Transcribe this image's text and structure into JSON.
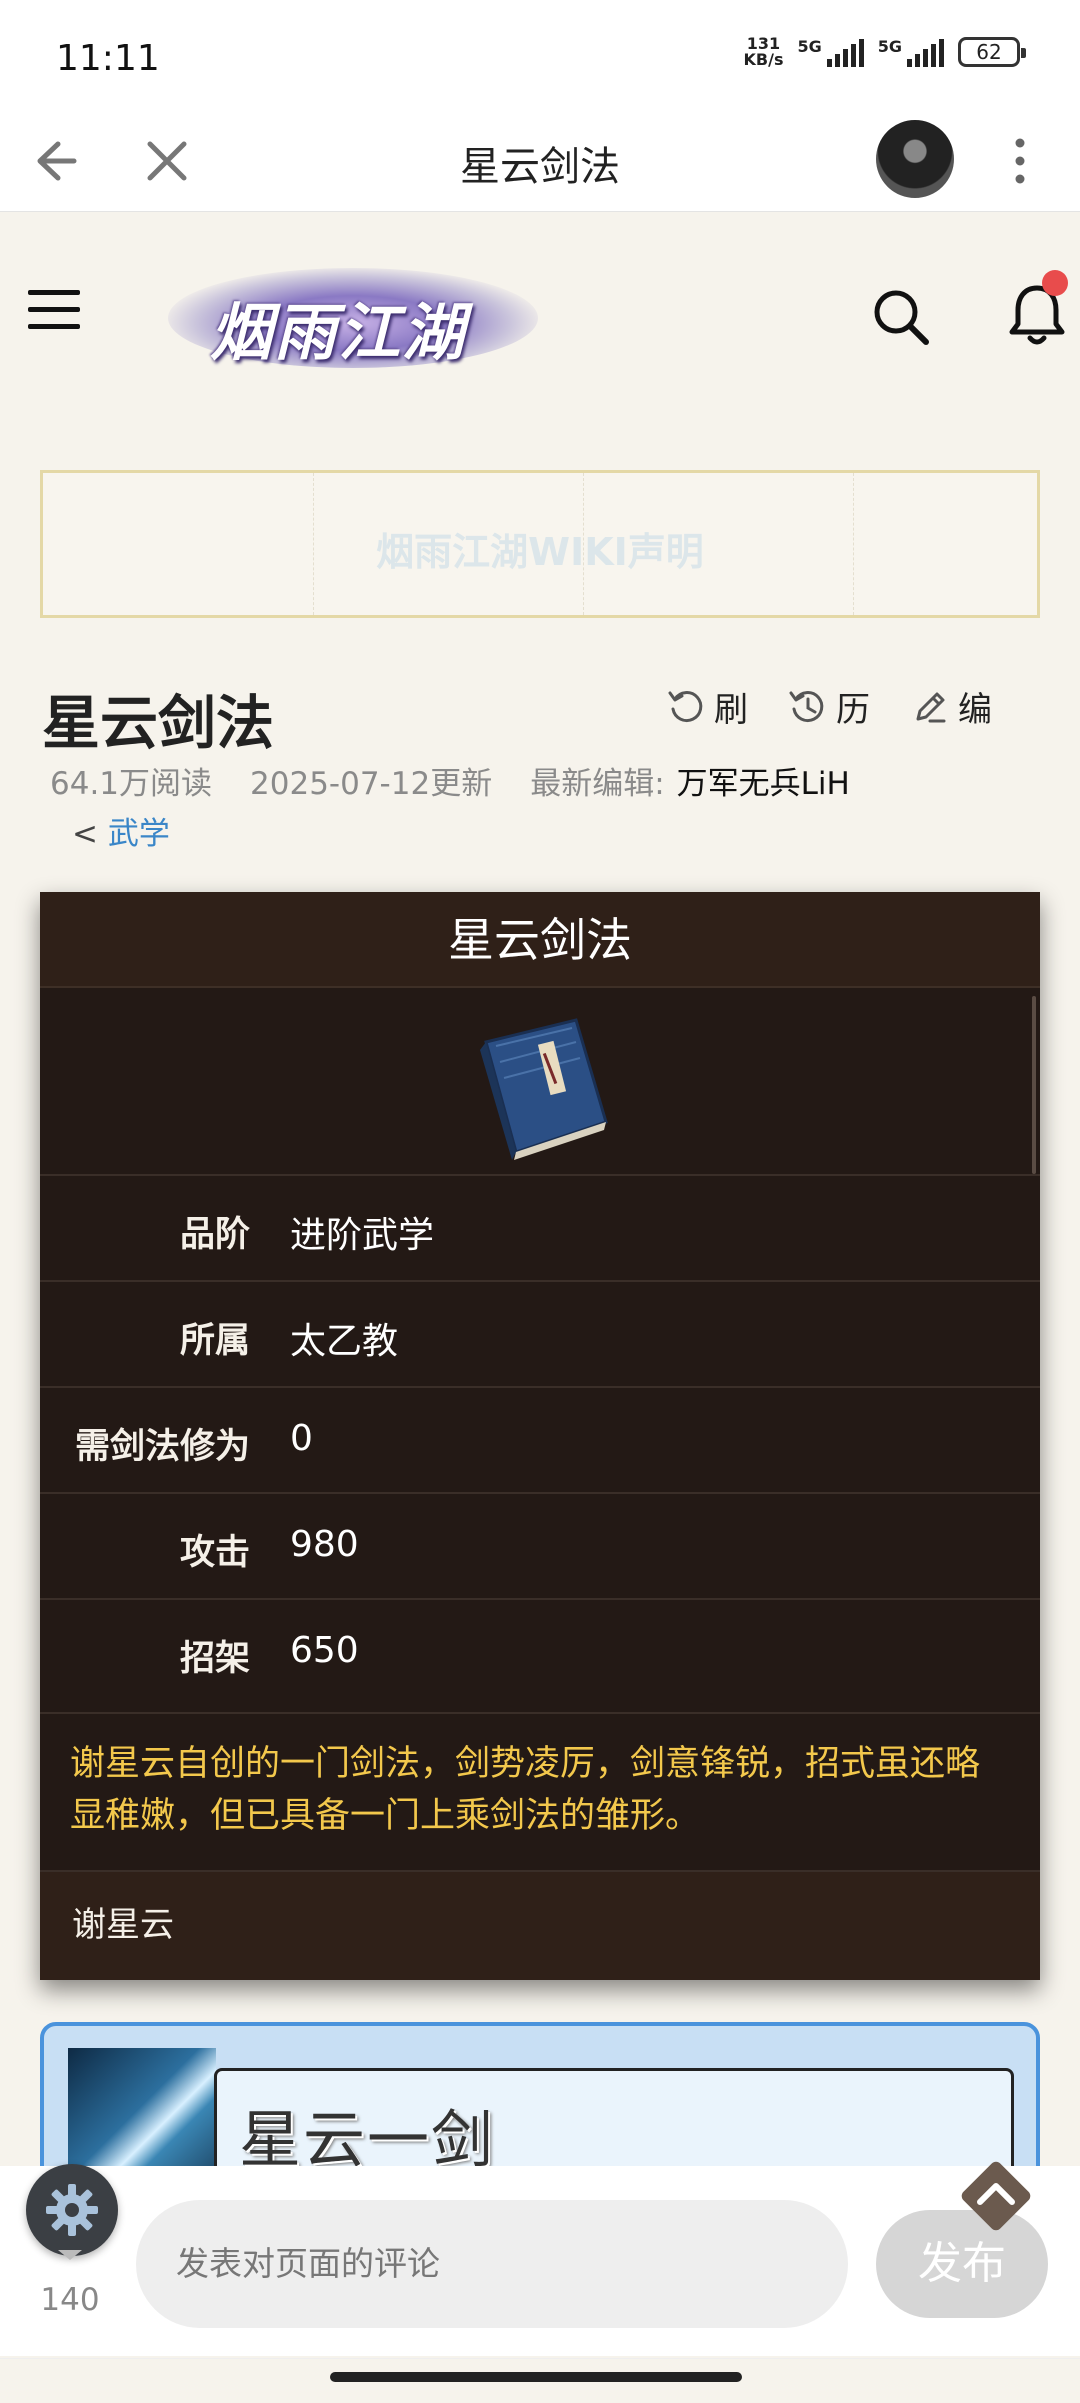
{
  "status_bar": {
    "time": "11:11",
    "net_speed_value": "131",
    "net_speed_unit": "KB/s",
    "signal_1": "5G",
    "signal_2": "5G",
    "battery": "62"
  },
  "nav": {
    "title": "星云剑法"
  },
  "site": {
    "logo_text": "烟雨江湖"
  },
  "notice": {
    "text": "烟雨江湖WIKI声明"
  },
  "page": {
    "title": "星云剑法",
    "actions": [
      {
        "label": "刷",
        "icon": "refresh-icon"
      },
      {
        "label": "历",
        "icon": "history-icon"
      },
      {
        "label": "编",
        "icon": "edit-icon"
      }
    ],
    "reads": "64.1万阅读",
    "updated": "2025-07-12更新",
    "latest_editor_label": "最新编辑:",
    "latest_editor": "万军无兵LiH",
    "breadcrumb_prefix": "<",
    "breadcrumb_link": "武学"
  },
  "info_card": {
    "title": "星云剑法",
    "rows": [
      {
        "label": "品阶",
        "value": "进阶武学"
      },
      {
        "label": "所属",
        "value": "太乙教"
      },
      {
        "label": "需剑法修为",
        "value": "0"
      },
      {
        "label": "攻击",
        "value": "980"
      },
      {
        "label": "招架",
        "value": "650"
      }
    ],
    "description": "谢星云自创的一门剑法，剑势凌厉，剑意锋锐，招式虽还略显稚嫩，但已具备一门上乘剑法的雏形。",
    "source": "谢星云"
  },
  "skill_card": {
    "name": "星云一剑"
  },
  "comment_bar": {
    "like_count": "140",
    "placeholder": "发表对页面的评论",
    "publish_label": "发布"
  },
  "colors": {
    "card_bg": "#231915",
    "desc_text": "#f3c84c",
    "link": "#3a86c8",
    "skill_border": "#4a93dc",
    "notification_dot": "#e84c4c"
  }
}
